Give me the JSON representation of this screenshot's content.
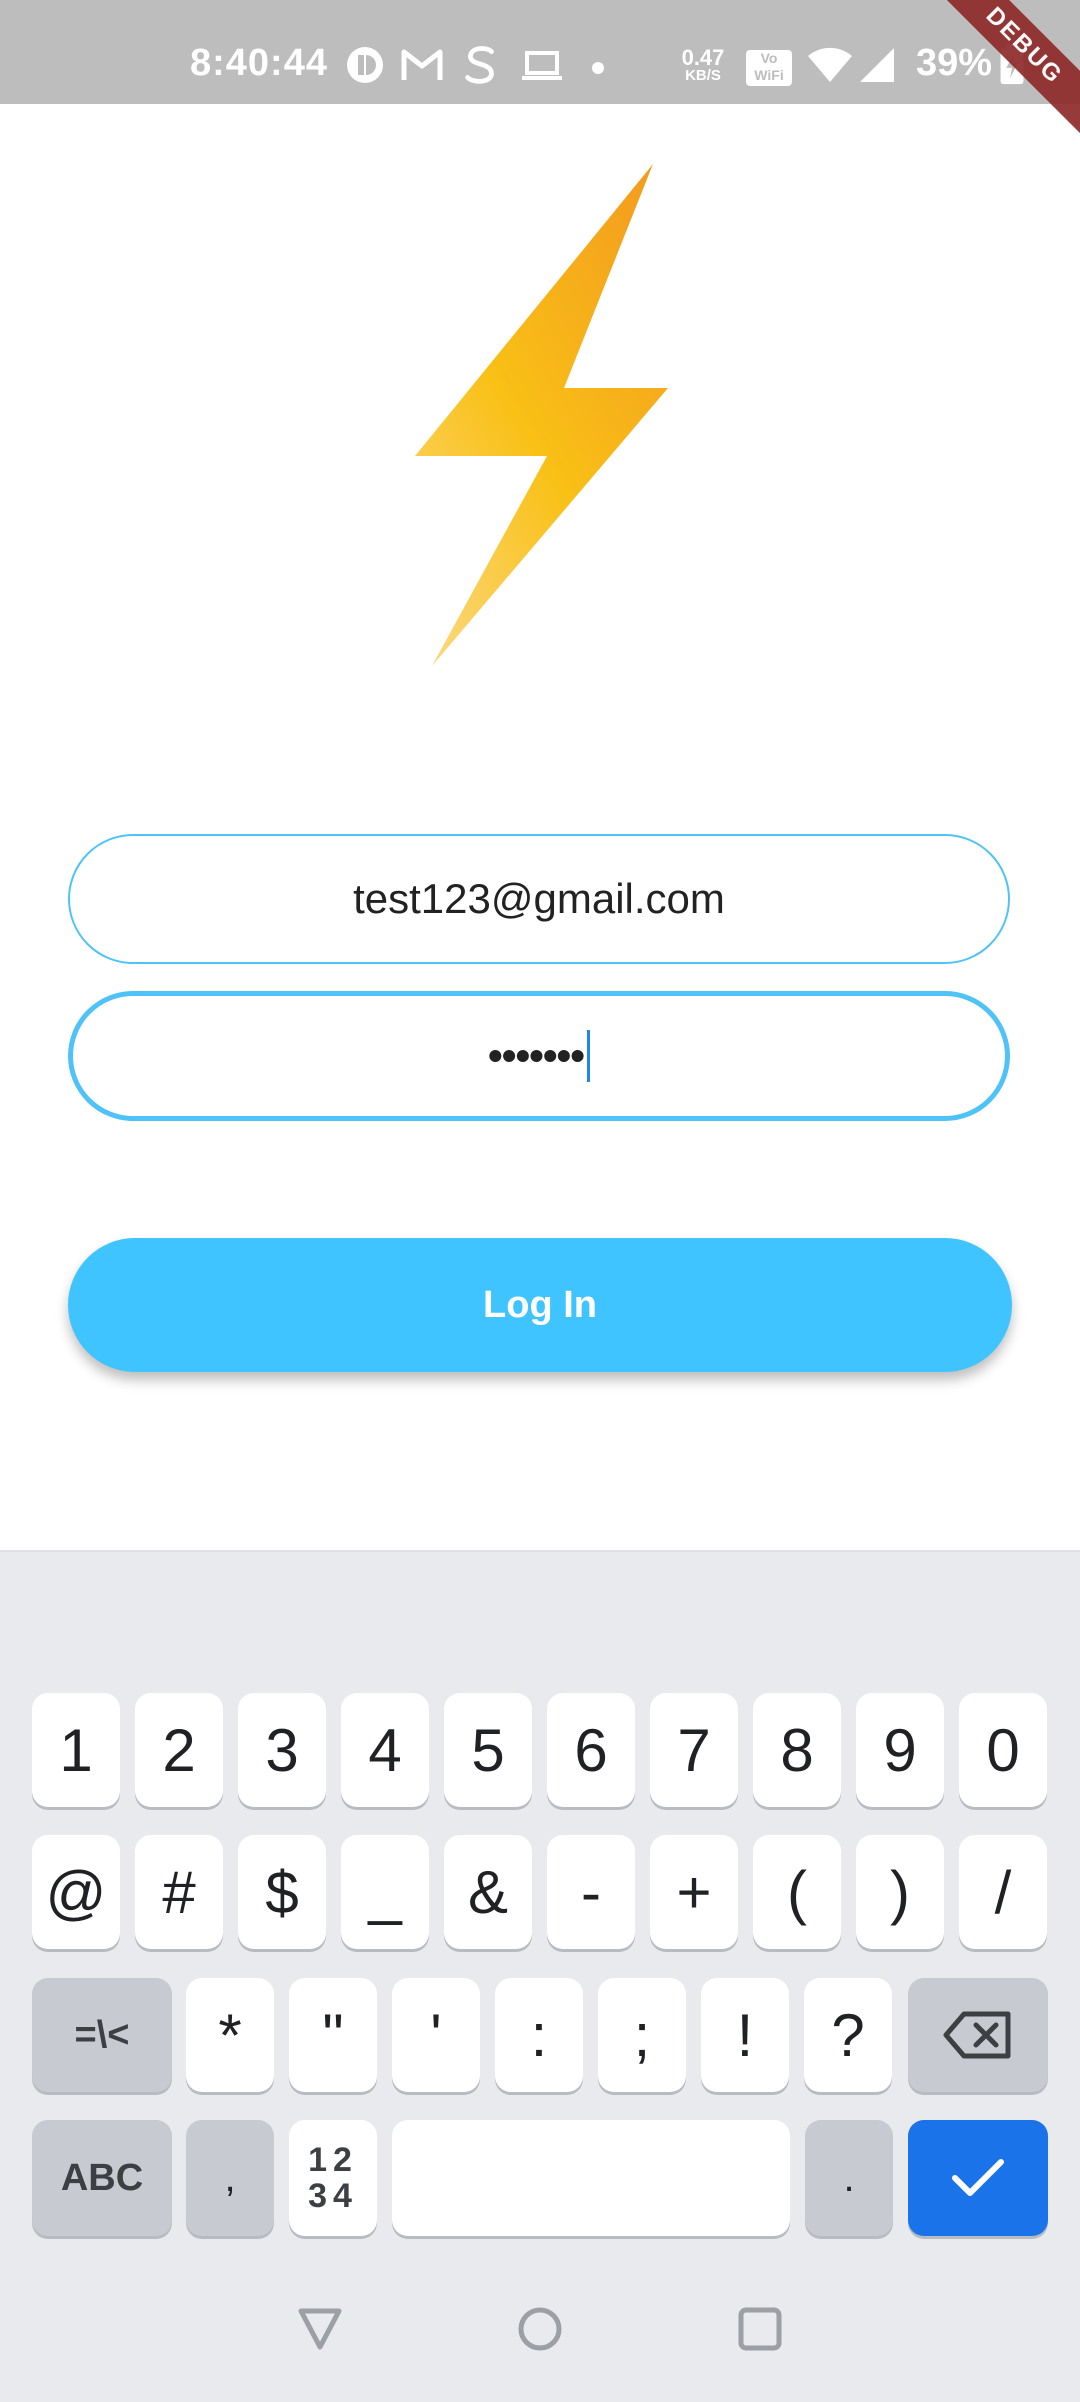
{
  "status_bar": {
    "time": "8:40:44",
    "net_speed_value": "0.47",
    "net_speed_unit": "KB/S",
    "volte_top": "Vo",
    "volte_bottom": "WiFi",
    "battery_percent": "39%"
  },
  "debug_banner": "DEBUG",
  "colors": {
    "accent": "#40c4ff",
    "field_border": "#4fc3f7",
    "status_bar_bg": "#bdbdbd",
    "keyboard_bg": "#e8eaed",
    "enter_key": "#1a73e8"
  },
  "login_form": {
    "email_value": "test123@gmail.com",
    "password_masked": "•••••••",
    "login_label": "Log In"
  },
  "keyboard": {
    "row1": [
      "1",
      "2",
      "3",
      "4",
      "5",
      "6",
      "7",
      "8",
      "9",
      "0"
    ],
    "row2": [
      "@",
      "#",
      "$",
      "_",
      "&",
      "-",
      "+",
      "(",
      ")",
      "/"
    ],
    "row3_mode": "=\\<",
    "row3": [
      "*",
      "\"",
      "'",
      ":",
      ";",
      "!",
      "?"
    ],
    "row4_abc": "ABC",
    "row4_comma": ",",
    "row4_numpad_top": "12",
    "row4_numpad_bottom": "34",
    "row4_period": "."
  },
  "icons": {
    "logo": "lightning-bolt-icon",
    "backspace": "backspace-icon",
    "enter": "checkmark-icon",
    "nav_back": "triangle-back-icon",
    "nav_home": "circle-home-icon",
    "nav_recents": "square-recents-icon"
  }
}
